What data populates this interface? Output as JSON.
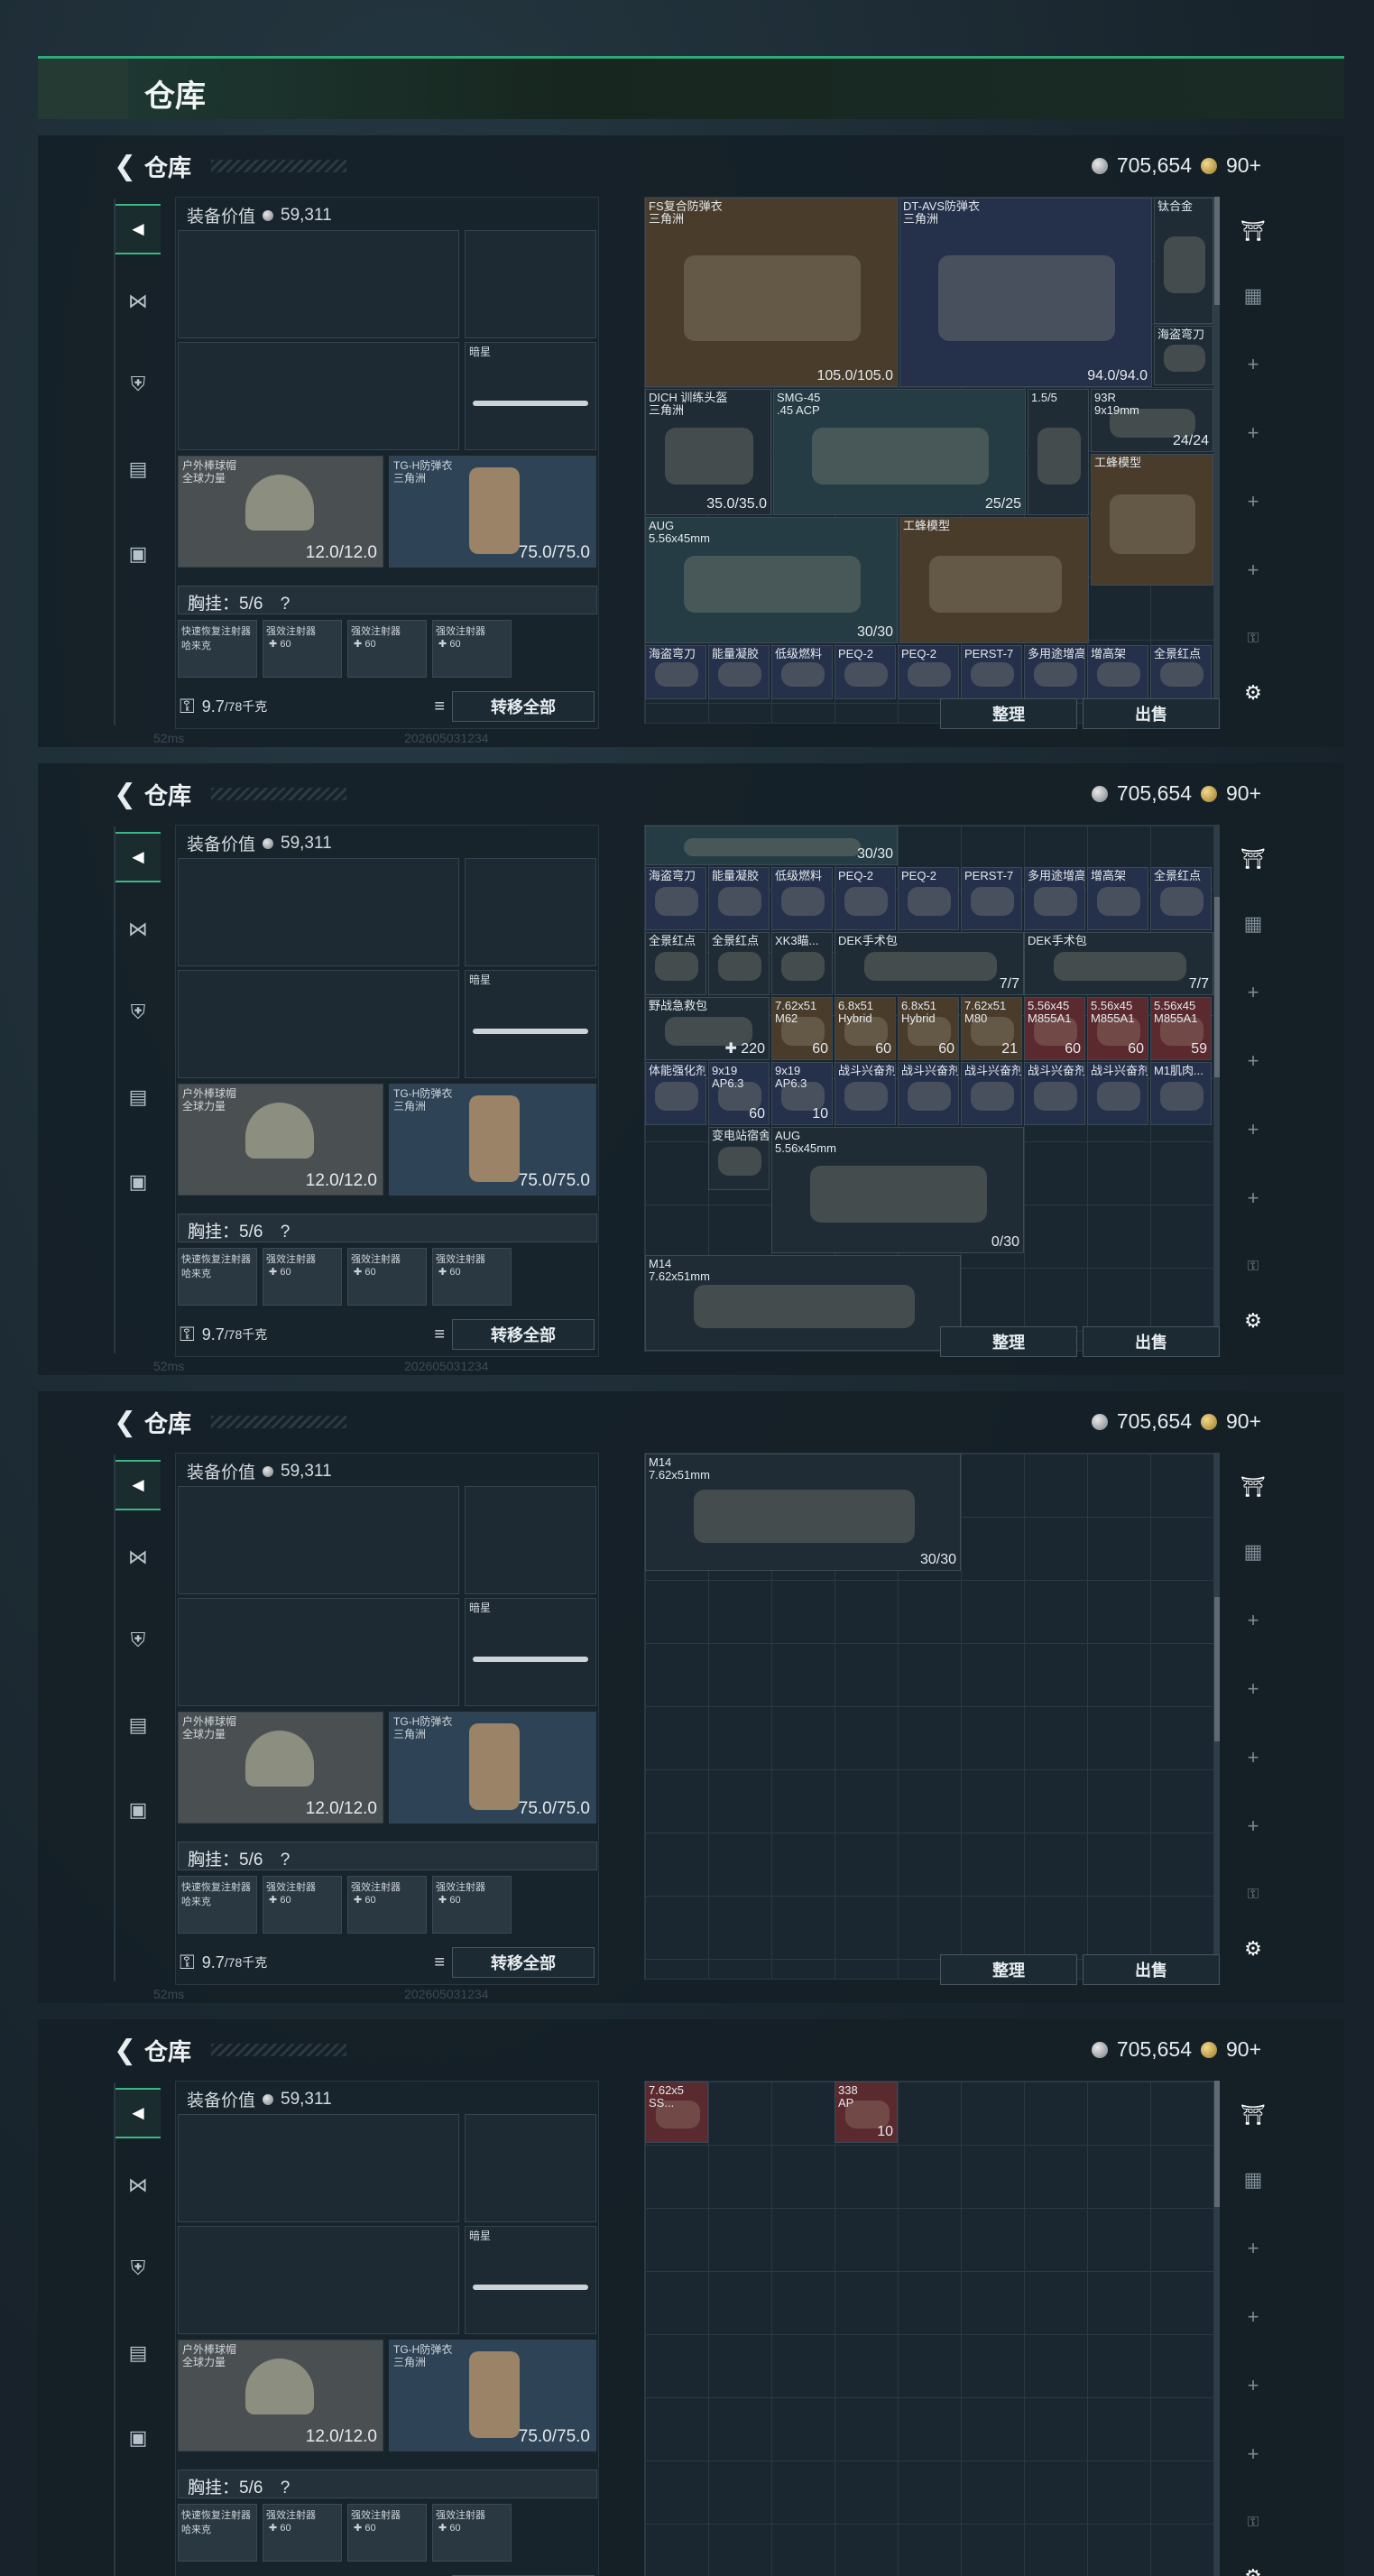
{
  "page": {
    "title": "仓库"
  },
  "header": {
    "back_label": "<",
    "title": "仓库",
    "currency_silver": "705,654",
    "currency_gold": "90+"
  },
  "loadout": {
    "value_label": "装备价值",
    "value": "59,311",
    "melee_label": "暗星",
    "helmet_label": "户外棒球帽\n全球力量",
    "helmet_dur": "12.0/12.0",
    "armor_label": "TG-H防弹衣\n三角洲",
    "armor_dur": "75.0/75.0",
    "chest_label": "胸挂：5/6",
    "chest_q": "?",
    "mini_slots": [
      "快速恢复注射器\n哈来克",
      "强效注射器\n ✚ 60",
      "强效注射器\n ✚ 60",
      "强效注射器\n ✚ 60"
    ],
    "weight": "9.7",
    "weight_max": "/78千克",
    "transfer_btn": "转移全部"
  },
  "actions": {
    "sort": "整理",
    "sell": "出售"
  },
  "footer": {
    "ping": "52ms",
    "build": "202605031234"
  },
  "stash_panels": [
    {
      "items": [
        {
          "name": "FS复合防弹衣\n三角洲",
          "value": "105.0/105.0"
        },
        {
          "name": "DT-AVS防弹衣\n三角洲",
          "value": "94.0/94.0"
        },
        {
          "name": "钛合金",
          "value": ""
        },
        {
          "name": "海盗弯刀",
          "value": ""
        },
        {
          "name": "DICH 训练头盔\n三角洲",
          "value": "35.0/35.0"
        },
        {
          "name": "SMG-45\n.45 ACP",
          "value": "25/25"
        },
        {
          "name": "1.5/5",
          "value": ""
        },
        {
          "name": "93R\n9x19mm",
          "value": "24/24"
        },
        {
          "name": "工蜂模型",
          "value": ""
        },
        {
          "name": "AUG\n5.56x45mm",
          "value": "30/30"
        },
        {
          "name": "工蜂模型",
          "value": ""
        },
        {
          "name": "海盗弯刀",
          "value": ""
        },
        {
          "name": "能量凝胶",
          "value": ""
        },
        {
          "name": "低级燃料",
          "value": ""
        },
        {
          "name": "PEQ-2",
          "value": ""
        },
        {
          "name": "PEQ-2",
          "value": ""
        },
        {
          "name": "PERST-7",
          "value": ""
        },
        {
          "name": "多用途增高",
          "value": ""
        },
        {
          "name": "增高架",
          "value": ""
        },
        {
          "name": "全景红点",
          "value": ""
        }
      ]
    },
    {
      "items": [
        {
          "name": "",
          "value": "30/30"
        },
        {
          "name": "海盗弯刀",
          "value": ""
        },
        {
          "name": "能量凝胶",
          "value": ""
        },
        {
          "name": "低级燃料",
          "value": ""
        },
        {
          "name": "PEQ-2",
          "value": ""
        },
        {
          "name": "PEQ-2",
          "value": ""
        },
        {
          "name": "PERST-7",
          "value": ""
        },
        {
          "name": "多用途增高",
          "value": ""
        },
        {
          "name": "增高架",
          "value": ""
        },
        {
          "name": "全景红点",
          "value": ""
        },
        {
          "name": "全景红点",
          "value": ""
        },
        {
          "name": "全景红点",
          "value": ""
        },
        {
          "name": "XK3瞄...",
          "value": ""
        },
        {
          "name": "DEK手术包",
          "value": "7/7"
        },
        {
          "name": "DEK手术包",
          "value": "7/7"
        },
        {
          "name": "野战急救包",
          "value": "✚ 220"
        },
        {
          "name": "7.62x51\nM62",
          "value": "60"
        },
        {
          "name": "6.8x51\nHybrid",
          "value": "60"
        },
        {
          "name": "6.8x51\nHybrid",
          "value": "60"
        },
        {
          "name": "7.62x51\nM80",
          "value": "21"
        },
        {
          "name": "5.56x45\nM855A1",
          "value": "60"
        },
        {
          "name": "5.56x45\nM855A1",
          "value": "60"
        },
        {
          "name": "5.56x45\nM855A1",
          "value": "59"
        },
        {
          "name": "体能强化剂",
          "value": ""
        },
        {
          "name": "9x19\nAP6.3",
          "value": "60"
        },
        {
          "name": "9x19\nAP6.3",
          "value": "10"
        },
        {
          "name": "战斗兴奋剂",
          "value": ""
        },
        {
          "name": "战斗兴奋剂",
          "value": ""
        },
        {
          "name": "战斗兴奋剂",
          "value": ""
        },
        {
          "name": "战斗兴奋剂",
          "value": ""
        },
        {
          "name": "战斗兴奋剂",
          "value": ""
        },
        {
          "name": "M1肌肉...",
          "value": ""
        },
        {
          "name": "变电站宿舍",
          "value": ""
        },
        {
          "name": "AUG\n5.56x45mm",
          "value": "0/30"
        },
        {
          "name": "M14\n7.62x51mm",
          "value": ""
        }
      ]
    },
    {
      "items": [
        {
          "name": "M14\n7.62x51mm",
          "value": "30/30"
        }
      ]
    },
    {
      "items": [
        {
          "name": "7.62x5\nSS...",
          "value": ""
        },
        {
          "name": "338\nAP",
          "value": "10"
        }
      ]
    }
  ]
}
